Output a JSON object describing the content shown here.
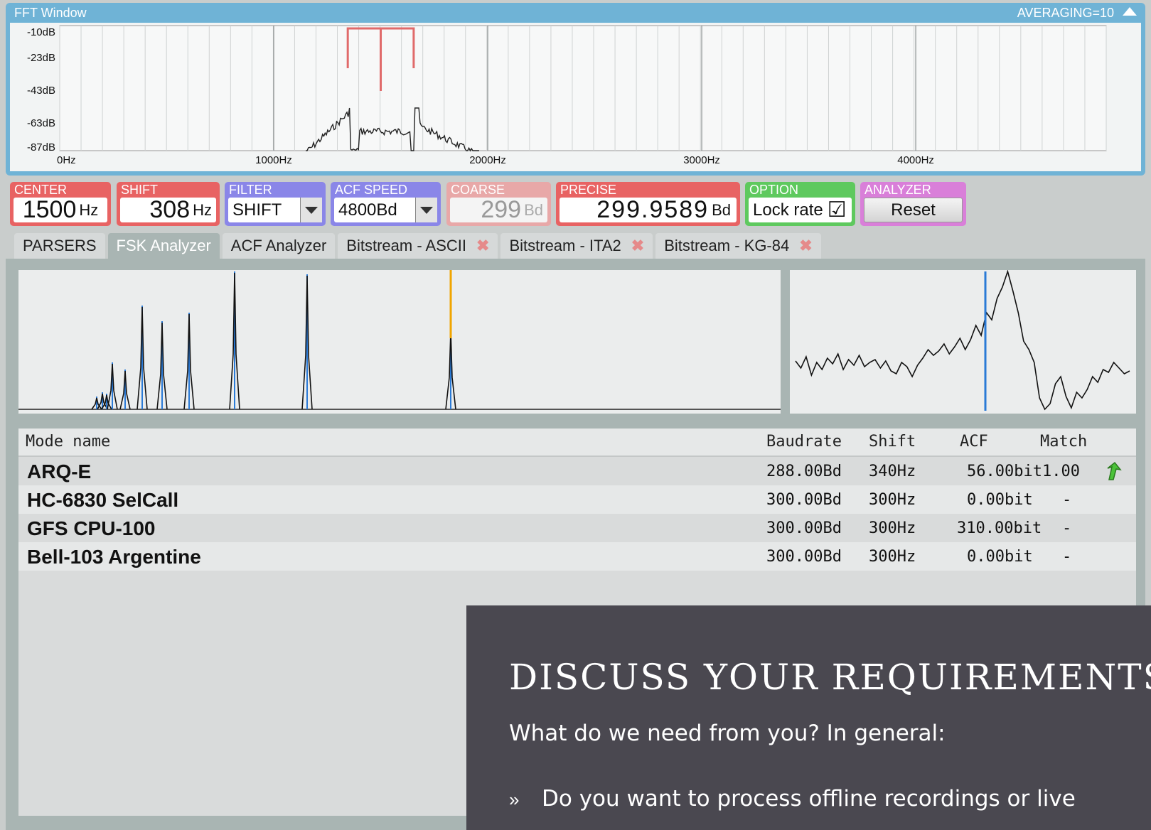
{
  "fft_window": {
    "title": "FFT Window",
    "averaging": "AVERAGING=10",
    "y_ticks": [
      "-10dB",
      "-23dB",
      "-43dB",
      "-63dB",
      "-87dB"
    ],
    "x_ticks": [
      "0Hz",
      "1000Hz",
      "2000Hz",
      "3000Hz",
      "4000Hz"
    ]
  },
  "controls": {
    "center": {
      "label": "CENTER",
      "value": "1500",
      "unit": "Hz",
      "color": "#e86363"
    },
    "shift": {
      "label": "SHIFT",
      "value": "308",
      "unit": "Hz",
      "color": "#e86363"
    },
    "filter": {
      "label": "FILTER",
      "value": "SHIFT",
      "color": "#8a86e8"
    },
    "acf_speed": {
      "label": "ACF SPEED",
      "value": "4800Bd",
      "color": "#8a86e8"
    },
    "coarse": {
      "label": "COARSE",
      "value": "299",
      "unit": "Bd",
      "color": "#e8a8a8"
    },
    "precise": {
      "label": "PRECISE",
      "value": "299.9589",
      "unit": "Bd",
      "color": "#e86363"
    },
    "option": {
      "label": "OPTION",
      "value": "Lock rate",
      "checked": "☑",
      "color": "#5ec95e"
    },
    "analyzer": {
      "label": "ANALYZER",
      "button": "Reset",
      "color": "#d97fd9"
    }
  },
  "tabs": [
    {
      "label": "PARSERS",
      "closable": false,
      "active": false
    },
    {
      "label": "FSK Analyzer",
      "closable": false,
      "active": true
    },
    {
      "label": "ACF Analyzer",
      "closable": false,
      "active": false
    },
    {
      "label": "Bitstream - ASCII",
      "closable": true,
      "active": false
    },
    {
      "label": "Bitstream - ITA2",
      "closable": true,
      "active": false
    },
    {
      "label": "Bitstream - KG-84",
      "closable": true,
      "active": false
    }
  ],
  "close_glyph": "✖",
  "table": {
    "headers": [
      "Mode name",
      "Baudrate",
      "Shift",
      "ACF",
      "Match"
    ],
    "rows": [
      {
        "name": "ARQ-E",
        "baudrate": "288.00Bd",
        "shift": "340Hz",
        "acf": "56.00bit",
        "match": "1.00",
        "icon": "green-arrow-icon"
      },
      {
        "name": "HC-6830 SelCall",
        "baudrate": "300.00Bd",
        "shift": "300Hz",
        "acf": "0.00bit",
        "match": "-"
      },
      {
        "name": "GFS CPU-100",
        "baudrate": "300.00Bd",
        "shift": "300Hz",
        "acf": "310.00bit",
        "match": "-"
      },
      {
        "name": "Bell-103 Argentine",
        "baudrate": "300.00Bd",
        "shift": "300Hz",
        "acf": "0.00bit",
        "match": "-"
      }
    ]
  },
  "overlay": {
    "title": "DISCUSS YOUR REQUIREMENTS",
    "subtitle": "What do we need from you? In general:",
    "bullet_mark": "»",
    "bullet": "Do you want to process offline recordings or live"
  }
}
